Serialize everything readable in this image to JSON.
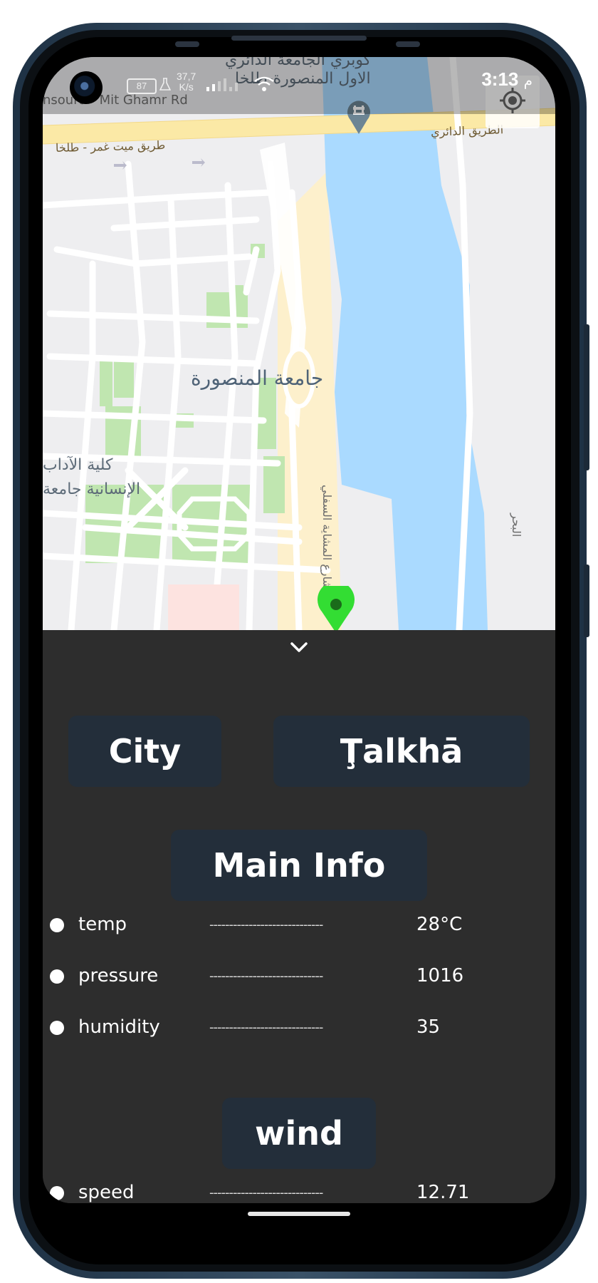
{
  "status_bar": {
    "time": "3:13",
    "am_pm": "م",
    "battery": "87",
    "network_speed": "37,7",
    "network_unit": "K/s"
  },
  "map": {
    "labels": {
      "bridge_top_1": "كوبري الجامعة الدائري",
      "bridge_top_2": "الاول المنصورة-طلخا",
      "road_left": "طريق ميت غمر - طلخا",
      "road_right": "الطريق الدائري",
      "mit_ghamr": "nsoura - Mit Ghamr Rd",
      "university": "جامعة المنصورة",
      "faculty_1": "كلية الآداب",
      "faculty_2": "الإنسانية جامعة",
      "street_vertical": "شارع المشاية السفلي",
      "sea_vertical": "البحر"
    }
  },
  "sheet": {
    "collapse_icon": "chevron-down-icon",
    "city_label": "City",
    "city_value": "Ţalkhā",
    "main_info_title": "Main Info",
    "dashes": "-----------------------------",
    "main_info": [
      {
        "label": "temp",
        "value": "28°C"
      },
      {
        "label": "pressure",
        "value": "1016"
      },
      {
        "label": "humidity",
        "value": "35"
      }
    ],
    "wind_title": "wind",
    "wind": [
      {
        "label": "speed",
        "value": "12.71"
      }
    ]
  },
  "colors": {
    "sheet_bg": "#2d2d2d",
    "chip_bg": "#232e3a",
    "water": "#aadaff",
    "park": "#c0e6b0",
    "road_major": "#fbe9a6",
    "pin": "#33dd33"
  }
}
